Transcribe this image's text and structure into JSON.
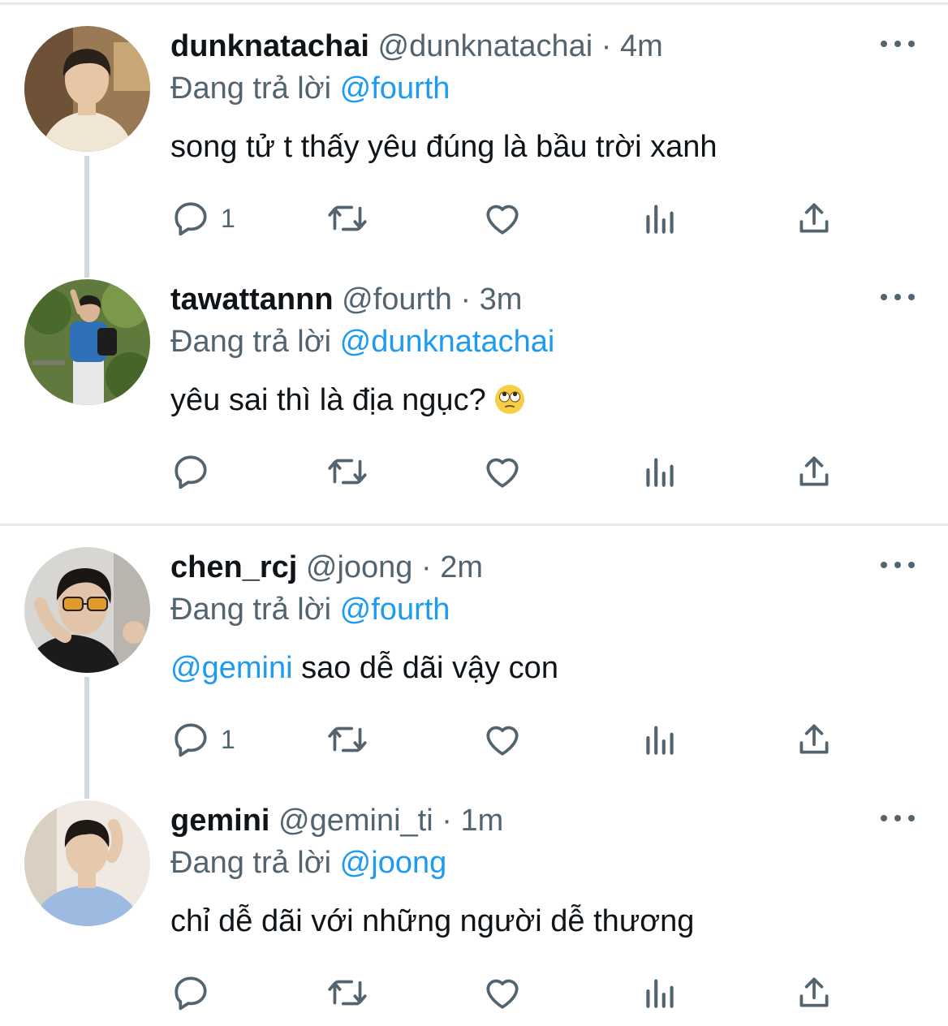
{
  "replying_label": "Đang trả lời",
  "tweets": [
    {
      "name": "dunknatachai",
      "handle": "@dunknatachai",
      "separator": "·",
      "time": "4m",
      "reply_to": "@fourth",
      "text": "song tử t thấy yêu đúng là bầu trời xanh",
      "reply_count": "1",
      "avatar_colors": {
        "bg": "#9a7a55",
        "skin": "#e7c6a6",
        "hair": "#2b211b",
        "shirt": "#efe6d6"
      }
    },
    {
      "name": "tawattannn",
      "handle": "@fourth",
      "separator": "·",
      "time": "3m",
      "reply_to": "@dunknatachai",
      "text": "yêu sai thì là địa ngục?",
      "emoji": "face-with-rolling-eyes",
      "reply_count": "",
      "avatar_colors": {
        "bg": "#5f7a3c",
        "skin": "#d9b596",
        "hair": "#1f1b18",
        "shirt": "#2f6fb8"
      }
    },
    {
      "name": "chen_rcj",
      "handle": "@joong",
      "separator": "·",
      "time": "2m",
      "reply_to": "@fourth",
      "text_mention": "@gemini",
      "text": " sao dễ dãi vậy con",
      "reply_count": "1",
      "avatar_colors": {
        "bg": "#d8d6d2",
        "skin": "#e2c4aa",
        "hair": "#1a1614",
        "shirt": "#1b1b1b"
      }
    },
    {
      "name": "gemini",
      "handle": "@gemini_ti",
      "separator": "·",
      "time": "1m",
      "reply_to": "@joong",
      "text": "chỉ dễ dãi với những người dễ thương",
      "reply_count": "",
      "avatar_colors": {
        "bg": "#efe9e1",
        "skin": "#e6c8ad",
        "hair": "#1e1915",
        "shirt": "#9dbbe0"
      }
    }
  ],
  "icons": [
    "reply-icon",
    "retweet-icon",
    "like-icon",
    "views-icon",
    "share-icon",
    "more-icon"
  ],
  "colors": {
    "text": "#0f1419",
    "secondary": "#536471",
    "accent": "#1d9bf0",
    "divider": "#e7e9ea",
    "thread": "#cfd9de"
  }
}
